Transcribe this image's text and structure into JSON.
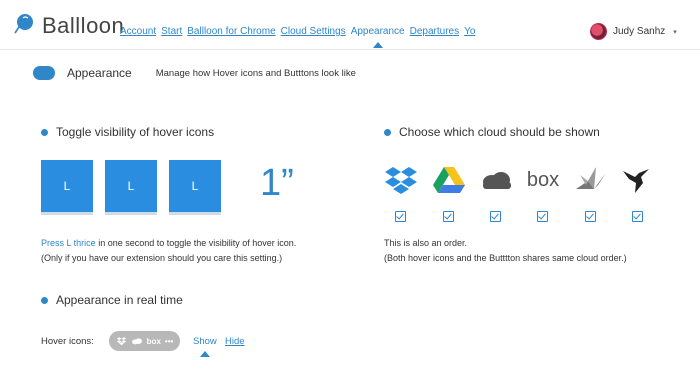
{
  "brand": {
    "name": "Ballloon"
  },
  "nav": {
    "items": [
      "Account",
      "Start",
      "Ballloon for Chrome",
      "Cloud Settings",
      "Appearance",
      "Departures",
      "Yo"
    ],
    "active": "Appearance"
  },
  "user": {
    "name": "Judy Sanhz",
    "caret": "▾"
  },
  "page": {
    "title": "Appearance",
    "description": "Manage how Hover icons and Butttons look like"
  },
  "toggle_section": {
    "heading": "Toggle visibility of hover icons",
    "keys": [
      "L",
      "L",
      "L"
    ],
    "seconds": "1”",
    "note_highlight": "Press L thrice",
    "note_rest": " in one second to toggle the visibility of hover icon.",
    "note_line2": "(Only if you have our extension should you care this setting.)"
  },
  "cloud_section": {
    "heading": "Choose which cloud should be shown",
    "clouds": [
      {
        "name": "Dropbox",
        "icon": "dropbox-icon",
        "checked": true
      },
      {
        "name": "Google Drive",
        "icon": "google-drive-icon",
        "checked": true
      },
      {
        "name": "OneDrive",
        "icon": "onedrive-icon",
        "checked": true
      },
      {
        "name": "Box",
        "icon": "box-icon",
        "label": "box",
        "checked": true
      },
      {
        "name": "Crane",
        "icon": "crane-icon",
        "checked": true
      },
      {
        "name": "Hummingbird",
        "icon": "hummingbird-icon",
        "checked": true
      }
    ],
    "note_line1": "This is also an order.",
    "note_line2": "(Both hover icons and the Butttton shares same cloud order.)"
  },
  "realtime_section": {
    "heading": "Appearance in real time",
    "hover_label": "Hover icons:",
    "pill_box_label": "box",
    "pill_more": "•••",
    "show_label": "Show",
    "hide_label": "Hide"
  },
  "colors": {
    "accent": "#2f86c9",
    "key_blue": "#2b8de0",
    "pill_gray": "#b8b8b8"
  }
}
